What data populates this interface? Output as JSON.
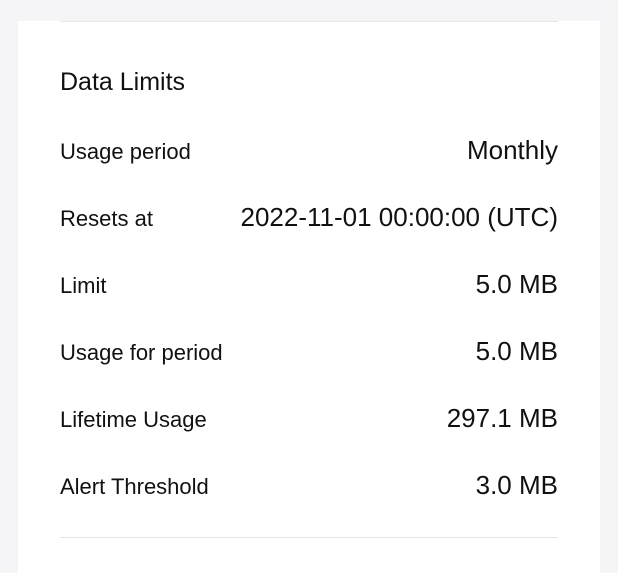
{
  "section": {
    "title": "Data Limits",
    "rows": [
      {
        "label": "Usage period",
        "value": "Monthly"
      },
      {
        "label": "Resets at",
        "value": "2022-11-01 00:00:00 (UTC)"
      },
      {
        "label": "Limit",
        "value": "5.0 MB"
      },
      {
        "label": "Usage for period",
        "value": "5.0 MB"
      },
      {
        "label": "Lifetime Usage",
        "value": "297.1 MB"
      },
      {
        "label": "Alert Threshold",
        "value": "3.0 MB"
      }
    ]
  }
}
